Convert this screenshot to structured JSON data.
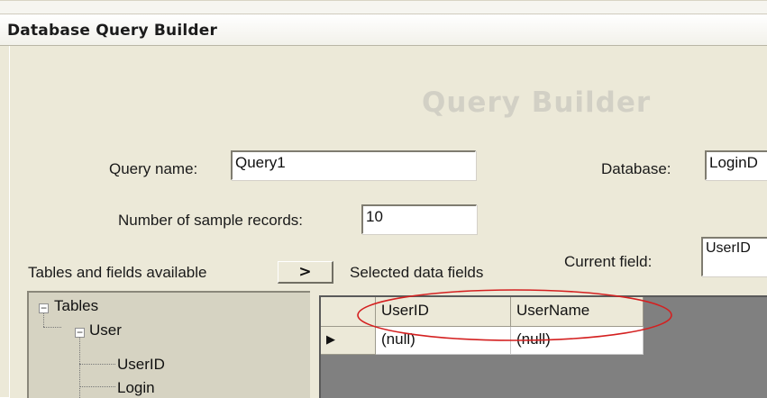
{
  "window": {
    "title": "Database Query Builder"
  },
  "form": {
    "heading": "Query Builder",
    "query_name_label": "Query name:",
    "query_name_value": "Query1",
    "database_label": "Database:",
    "database_value": "LoginD",
    "sample_records_label": "Number of sample records:",
    "sample_records_value": "10",
    "current_field_label": "Current field:",
    "current_field_value": "UserID",
    "tables_label": "Tables and fields available",
    "add_button_label": ">",
    "selected_label": "Selected data fields"
  },
  "tree": {
    "root": {
      "label": "Tables",
      "expander": "−"
    },
    "table": {
      "label": "User",
      "expander": "−"
    },
    "fields": [
      "UserID",
      "Login"
    ]
  },
  "grid": {
    "columns": [
      "UserID",
      "UserName"
    ],
    "rows": [
      {
        "indicator": "▶",
        "cells": [
          "(null)",
          "(null)"
        ]
      }
    ]
  },
  "colors": {
    "window_bg": "#ece9d8",
    "heading": "#d2d0c5",
    "annotation": "#d42020",
    "grid_empty": "#808080"
  }
}
